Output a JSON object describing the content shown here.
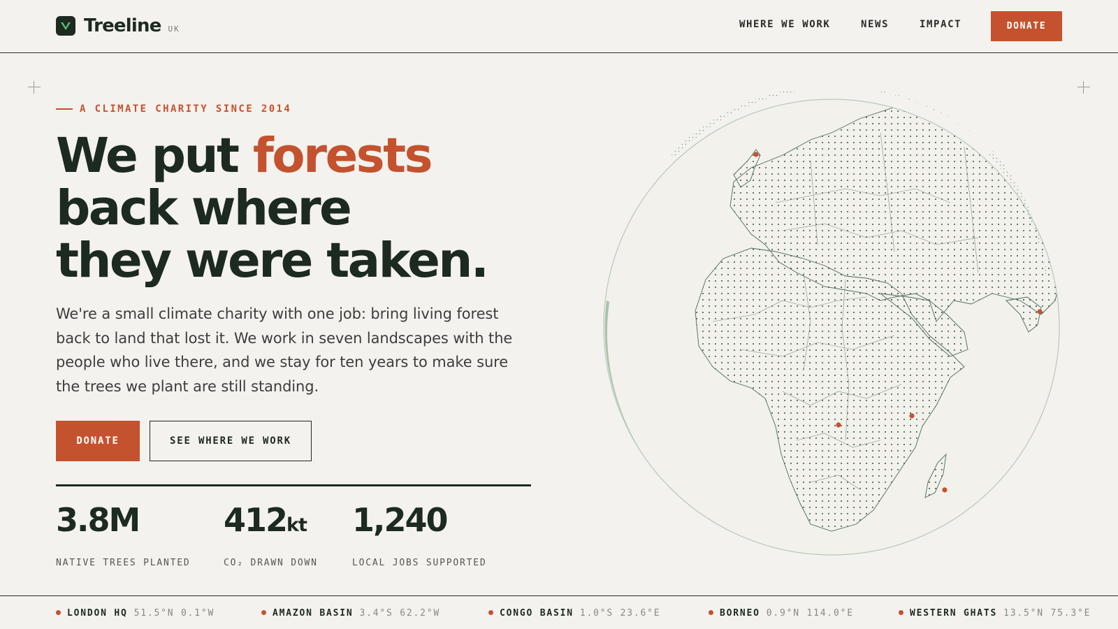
{
  "brand": {
    "name": "Treeline",
    "region": "UK",
    "accent": "#c4522e",
    "ink": "#1c2a20",
    "background": "#f4f2ee"
  },
  "nav": {
    "items": [
      "WHERE WE WORK",
      "NEWS",
      "IMPACT"
    ],
    "donate_label": "DONATE"
  },
  "hero": {
    "eyebrow": "A CLIMATE CHARITY SINCE 2014",
    "headline": {
      "line1_start": "We put",
      "line1_accent": "forests",
      "line2": "back where",
      "line3": "they were taken."
    },
    "lede": "We're a small climate charity with one job: bring living forest back to land that lost it. We work in seven landscapes with the people who live there, and we stay for ten years to make sure the trees we plant are still standing.",
    "primary_cta": "DONATE",
    "secondary_cta": "SEE WHERE WE WORK"
  },
  "stats": [
    {
      "value": "3.8M",
      "unit": "",
      "label": "NATIVE TREES PLANTED"
    },
    {
      "value": "412",
      "unit": "kt",
      "label": "CO₂ DRAWN DOWN"
    },
    {
      "value": "1,240",
      "unit": "",
      "label": "LOCAL JOBS SUPPORTED"
    }
  ],
  "globe": {
    "icon": "dotted-globe-africa-europe",
    "marker_color": "#c4522e"
  },
  "locations": [
    {
      "name": "LONDON HQ",
      "coords": "51.5°N 0.1°W"
    },
    {
      "name": "AMAZON BASIN",
      "coords": "3.4°S 62.2°W"
    },
    {
      "name": "CONGO BASIN",
      "coords": "1.0°S 23.6°E"
    },
    {
      "name": "BORNEO",
      "coords": "0.9°N 114.0°E"
    },
    {
      "name": "WESTERN GHATS",
      "coords": "13.5°N 75.3°E"
    }
  ]
}
